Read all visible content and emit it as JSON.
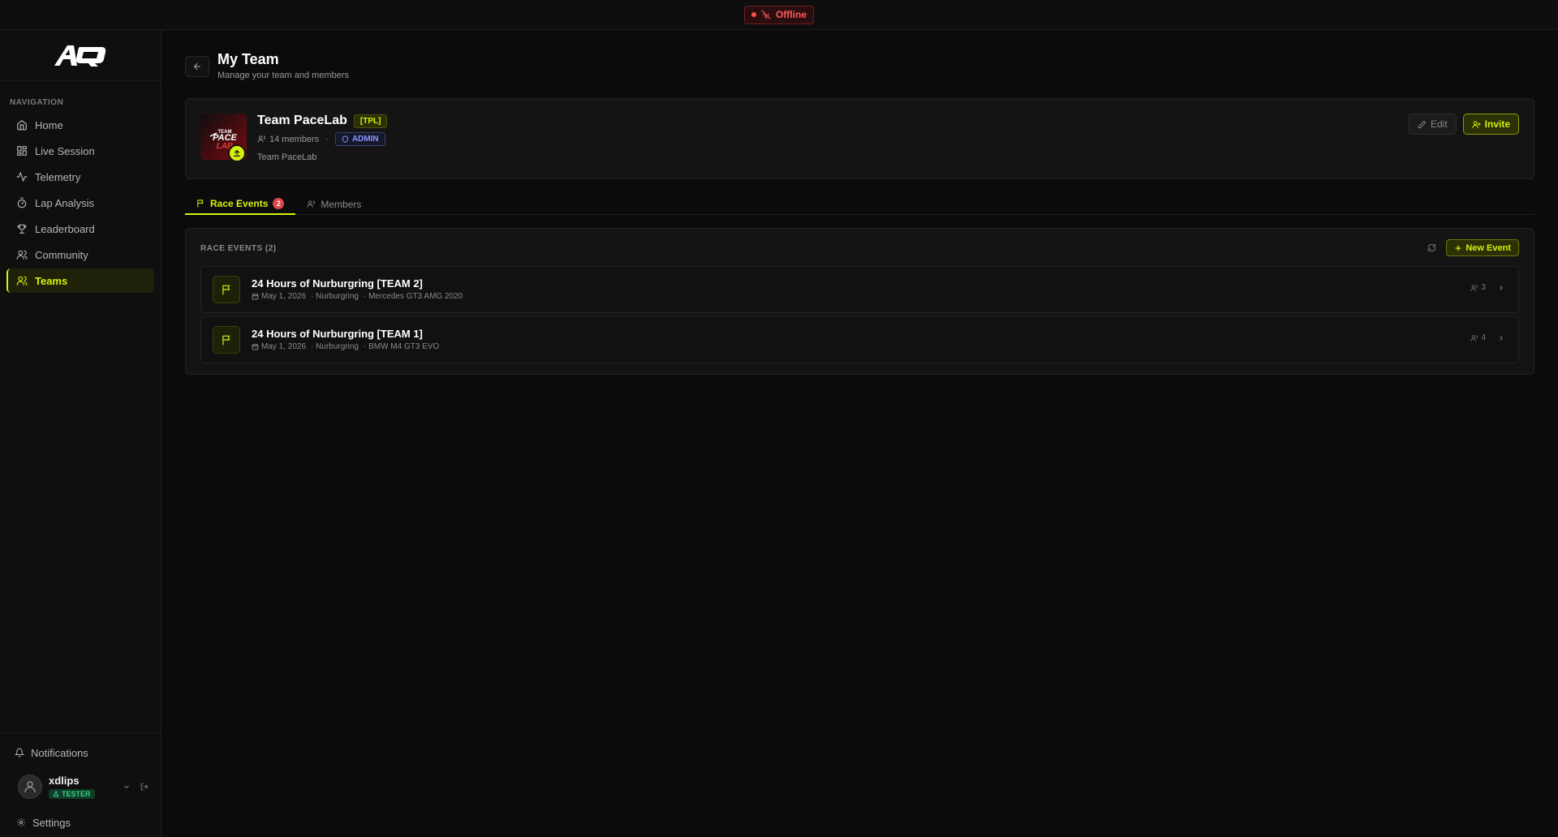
{
  "status": {
    "label": "Offline",
    "color": "#ff5c5c"
  },
  "brand": {
    "logo_icon": "aq-logo-icon"
  },
  "sidebar": {
    "heading": "NAVIGATION",
    "items": [
      {
        "label": "Home",
        "icon": "home-icon"
      },
      {
        "label": "Live Session",
        "icon": "grid-icon"
      },
      {
        "label": "Telemetry",
        "icon": "activity-icon"
      },
      {
        "label": "Lap Analysis",
        "icon": "stopwatch-icon"
      },
      {
        "label": "Leaderboard",
        "icon": "trophy-icon"
      },
      {
        "label": "Community",
        "icon": "users-icon"
      },
      {
        "label": "Teams",
        "icon": "team-icon",
        "active": true
      }
    ],
    "notifications_label": "Notifications",
    "user": {
      "name": "xdlips",
      "role": "TESTER"
    },
    "settings_label": "Settings"
  },
  "page": {
    "title": "My Team",
    "subtitle": "Manage your team and members"
  },
  "team": {
    "name": "Team PaceLab",
    "tag": "[TPL]",
    "members_count": "14 members",
    "separator": "·",
    "role": "ADMIN",
    "description": "Team PaceLab",
    "edit_label": "Edit",
    "invite_label": "Invite"
  },
  "tabs": [
    {
      "label": "Race Events",
      "count": "2",
      "active": true
    },
    {
      "label": "Members"
    }
  ],
  "events": {
    "heading": "RACE EVENTS (2)",
    "new_event_label": "New Event",
    "items": [
      {
        "title": "24 Hours of Nurburgring [TEAM 2]",
        "date": "May 1, 2026",
        "track": "· Nurburgring",
        "car": "· Mercedes GT3 AMG 2020",
        "drivers": "3"
      },
      {
        "title": "24 Hours of Nurburgring [TEAM 1]",
        "date": "May 1, 2026",
        "track": "· Nurburgring",
        "car": "· BMW M4 GT3 EVO",
        "drivers": "4"
      }
    ]
  },
  "colors": {
    "accent": "#d7f10f",
    "background": "#0b0b0b",
    "danger": "#e04848",
    "admin": "#8c95ff",
    "tester": "#35d07f"
  }
}
